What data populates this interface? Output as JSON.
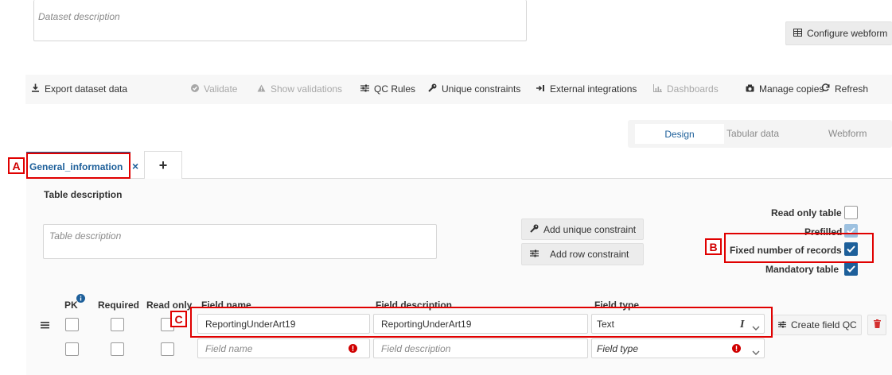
{
  "dataset": {
    "description_placeholder": "Dataset description",
    "configure_webform": "Configure webform"
  },
  "toolbar": {
    "export": "Export dataset data",
    "validate": "Validate",
    "show_validations": "Show validations",
    "qc_rules": "QC Rules",
    "unique_constraints": "Unique constraints",
    "external_integrations": "External integrations",
    "dashboards": "Dashboards",
    "manage_copies": "Manage copies",
    "refresh": "Refresh"
  },
  "view_modes": {
    "design": "Design",
    "tabular": "Tabular data",
    "webform": "Webform"
  },
  "tabs": {
    "active": "General_information",
    "close": "×",
    "add": "+"
  },
  "table": {
    "description_label": "Table description",
    "description_placeholder": "Table description",
    "add_unique_constraint": "Add unique constraint",
    "add_row_constraint": "Add row constraint",
    "read_only_table": "Read only table",
    "prefilled": "Prefilled",
    "fixed_number_of_records": "Fixed number of records",
    "mandatory_table": "Mandatory table"
  },
  "columns": {
    "pk": "PK",
    "required": "Required",
    "read_only": "Read only",
    "field_name": "Field name",
    "field_description": "Field description",
    "field_type": "Field type"
  },
  "rows": [
    {
      "field_name": "ReportingUnderArt19",
      "field_description": "ReportingUnderArt19",
      "field_type": "Text",
      "create_field_qc": "Create field QC"
    },
    {
      "field_name_placeholder": "Field name",
      "field_description_placeholder": "Field description",
      "field_type_placeholder": "Field type"
    }
  ],
  "annotations": {
    "a": "A",
    "b": "B",
    "c": "C"
  },
  "colors": {
    "accent": "#1d5f9a",
    "annotation": "#e00000",
    "danger": "#d32f2f"
  }
}
